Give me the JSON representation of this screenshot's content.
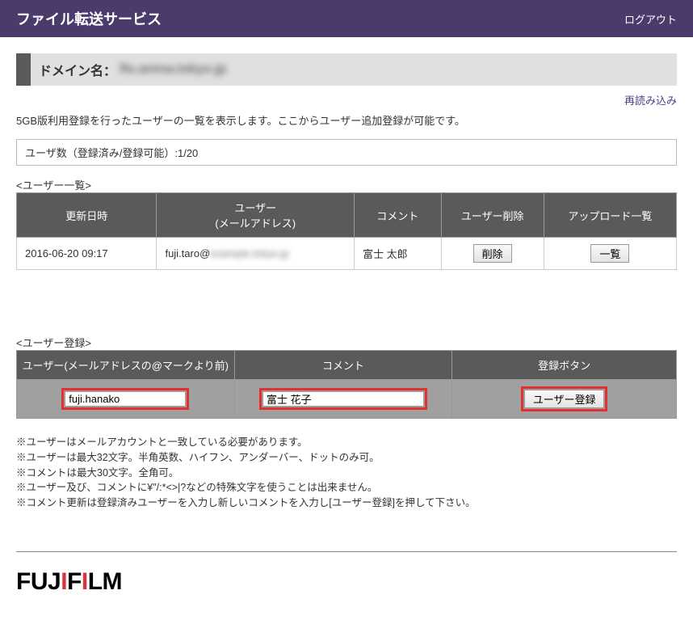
{
  "header": {
    "title": "ファイル転送サービス",
    "logout": "ログアウト"
  },
  "domain": {
    "label": "ドメイン名：",
    "value": "fts.arena.tokyo.jp"
  },
  "reload": "再読み込み",
  "description": "5GB版利用登録を行ったユーザーの一覧を表示します。ここからユーザー追加登録が可能です。",
  "user_count": {
    "label": "ユーザ数（登録済み/登録可能）",
    "value": ":1/20"
  },
  "user_list": {
    "section": "<ユーザー一覧>",
    "headers": {
      "updated": "更新日時",
      "user": "ユーザー",
      "user_sub": "(メールアドレス)",
      "comment": "コメント",
      "delete": "ユーザー削除",
      "uploads": "アップロード一覧"
    },
    "rows": [
      {
        "updated": "2016-06-20 09:17",
        "email_prefix": "fuji.taro@",
        "email_suffix": "example.tokyo.jp",
        "comment": "富士 太郎",
        "delete_btn": "削除",
        "list_btn": "一覧"
      }
    ]
  },
  "user_reg": {
    "section": "<ユーザー登録>",
    "headers": {
      "user": "ユーザー(メールアドレスの@マークより前)",
      "comment": "コメント",
      "button": "登録ボタン"
    },
    "input_user": "fuji.hanako",
    "input_comment": "富士 花子",
    "submit": "ユーザー登録"
  },
  "notes": [
    "※ユーザーはメールアカウントと一致している必要があります。",
    "※ユーザーは最大32文字。半角英数、ハイフン、アンダーバー、ドットのみ可。",
    "※コメントは最大30文字。全角可。",
    "※ユーザー及び、コメントに¥\"/:*<>|?などの特殊文字を使うことは出来ません。",
    "※コメント更新は登録済みユーザーを入力し新しいコメントを入力し[ユーザー登録]を押して下さい。"
  ],
  "logo": {
    "p1": "FUJ",
    "p2": "I",
    "p3": "F",
    "p4": "I",
    "p5": "LM"
  }
}
